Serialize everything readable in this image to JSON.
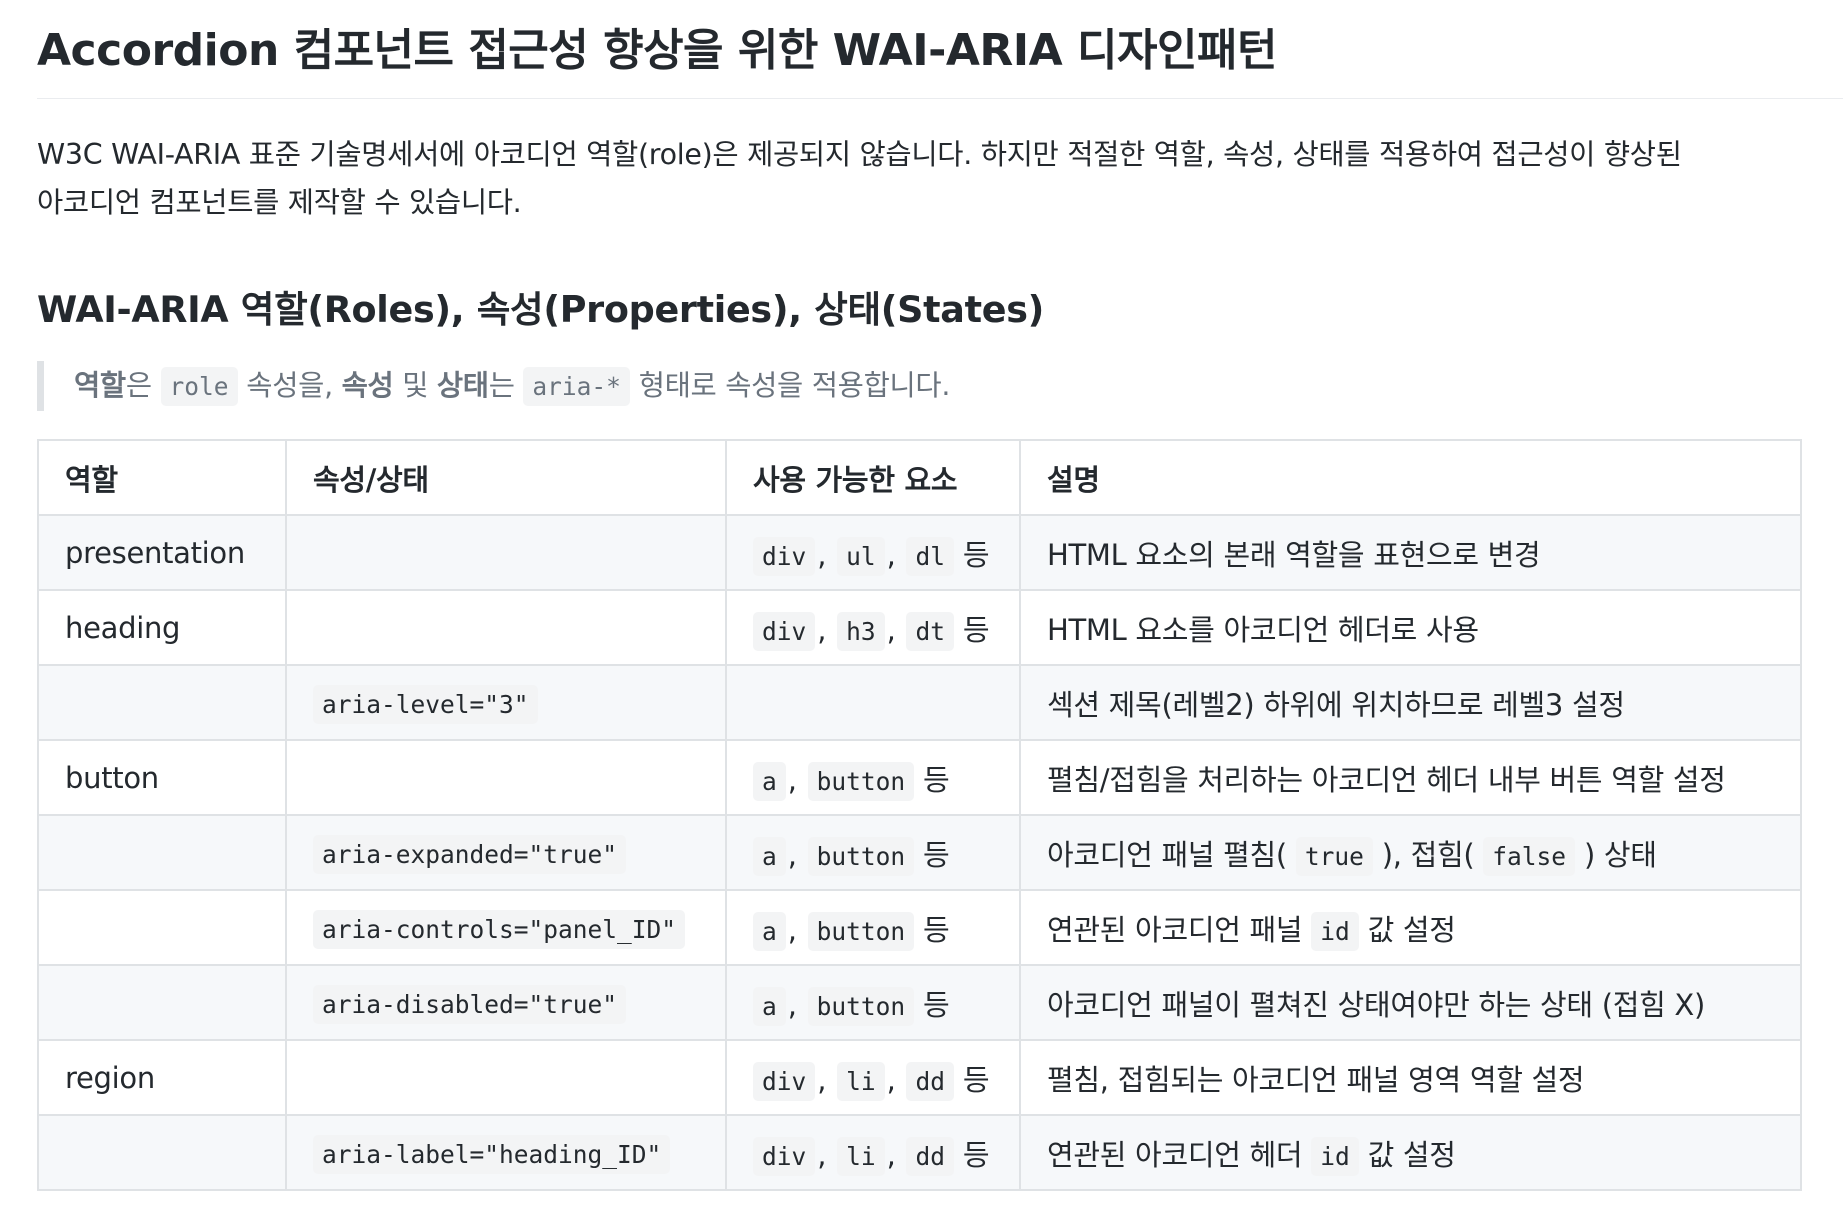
{
  "title": "Accordion 컴포넌트 접근성 향상을 위한 WAI-ARIA 디자인패턴",
  "intro": {
    "line1": "W3C WAI-ARIA 표준 기술명세서에 아코디언 역할(role)은 제공되지 않습니다. 하지만 적절한 역할, 속성, 상태를 적용하여 접근성이 향상된",
    "line2": "아코디언 컴포넌트를 제작할 수 있습니다."
  },
  "section_heading": "WAI-ARIA 역할(Roles), 속성(Properties), 상태(States)",
  "note": {
    "bold_role": "역할",
    "t1": "은 ",
    "code_role": "role",
    "t2": " 속성을, ",
    "bold_prop": "속성",
    "t3": " 및 ",
    "bold_state": "상태",
    "t4": "는 ",
    "code_aria": "aria-*",
    "t5": " 형태로 속성을 적용합니다."
  },
  "table": {
    "headers": [
      "역할",
      "속성/상태",
      "사용 가능한 요소",
      "설명"
    ],
    "rows": [
      {
        "role": "presentation",
        "attr": "",
        "elements": [
          "div",
          "ul",
          "dl"
        ],
        "suffix": "등",
        "desc": [
          {
            "t": "HTML 요소의 본래 역할을 표현으로 변경"
          }
        ]
      },
      {
        "role": "heading",
        "attr": "",
        "elements": [
          "div",
          "h3",
          "dt"
        ],
        "suffix": "등",
        "desc": [
          {
            "t": "HTML 요소를 아코디언 헤더로 사용"
          }
        ]
      },
      {
        "role": "",
        "attr": "aria-level=\"3\"",
        "elements": [],
        "suffix": "",
        "desc": [
          {
            "t": "섹션 제목(레벨2) 하위에 위치하므로 레벨3 설정"
          }
        ]
      },
      {
        "role": "button",
        "attr": "",
        "elements": [
          "a",
          "button"
        ],
        "suffix": "등",
        "desc": [
          {
            "t": "펼침/접힘을 처리하는 아코디언 헤더 내부 버튼 역할 설정"
          }
        ]
      },
      {
        "role": "",
        "attr": "aria-expanded=\"true\"",
        "elements": [
          "a",
          "button"
        ],
        "suffix": "등",
        "desc": [
          {
            "t": "아코디언 패널 펼침( "
          },
          {
            "c": "true"
          },
          {
            "t": " ), 접힘( "
          },
          {
            "c": "false"
          },
          {
            "t": " ) 상태"
          }
        ]
      },
      {
        "role": "",
        "attr": "aria-controls=\"panel_ID\"",
        "elements": [
          "a",
          "button"
        ],
        "suffix": "등",
        "desc": [
          {
            "t": "연관된 아코디언 패널 "
          },
          {
            "c": "id"
          },
          {
            "t": " 값 설정"
          }
        ]
      },
      {
        "role": "",
        "attr": "aria-disabled=\"true\"",
        "elements": [
          "a",
          "button"
        ],
        "suffix": "등",
        "desc": [
          {
            "t": "아코디언 패널이 펼쳐진 상태여야만 하는 상태 (접힘 X)"
          }
        ]
      },
      {
        "role": "region",
        "attr": "",
        "elements": [
          "div",
          "li",
          "dd"
        ],
        "suffix": "등",
        "desc": [
          {
            "t": "펼침, 접힘되는 아코디언 패널 영역 역할 설정"
          }
        ]
      },
      {
        "role": "",
        "attr": "aria-label=\"heading_ID\"",
        "elements": [
          "div",
          "li",
          "dd"
        ],
        "suffix": "등",
        "desc": [
          {
            "t": "연관된 아코디언 헤더 "
          },
          {
            "c": "id"
          },
          {
            "t": " 값 설정"
          }
        ]
      }
    ]
  }
}
